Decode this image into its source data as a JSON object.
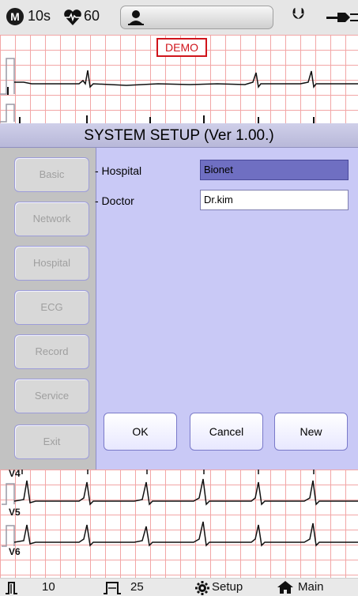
{
  "status_bar": {
    "mode_letter": "M",
    "interval": "10s",
    "heart_rate": "60",
    "icons": [
      "mode-icon",
      "heart-icon",
      "patient-icon",
      "usb-icon",
      "plug-icon"
    ]
  },
  "ecg": {
    "demo_label": "DEMO",
    "leads_bottom": [
      "V4",
      "V5",
      "V6"
    ]
  },
  "dialog": {
    "title": "SYSTEM SETUP (Ver 1.00.)",
    "menu": [
      {
        "label": "Basic"
      },
      {
        "label": "Network"
      },
      {
        "label": "Hospital"
      },
      {
        "label": "ECG"
      },
      {
        "label": "Record"
      },
      {
        "label": "Service"
      },
      {
        "label": "Exit"
      }
    ],
    "fields": {
      "hospital_label": "- Hospital",
      "hospital_value": "Bionet",
      "doctor_label": "- Doctor",
      "doctor_value": "Dr.kim"
    },
    "buttons": {
      "ok": "OK",
      "cancel": "Cancel",
      "new": "New"
    }
  },
  "bottom_bar": {
    "sensitivity": "10",
    "speed": "25",
    "setup": "Setup",
    "main": "Main"
  },
  "colors": {
    "dialog_bg": "#c9c9f6",
    "selected_field": "#6f6fc2",
    "grid": "#f2a6a6",
    "demo_border": "#d0141b"
  }
}
